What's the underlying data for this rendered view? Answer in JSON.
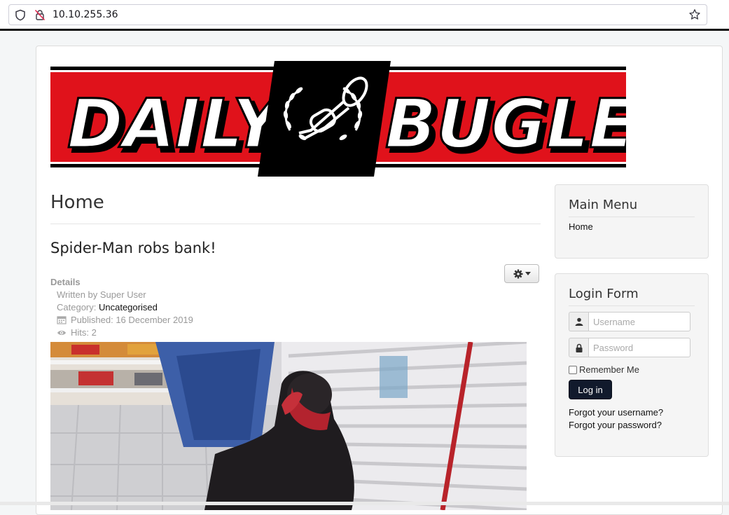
{
  "browser": {
    "url": "10.10.255.36"
  },
  "logo": {
    "word_left": "DAILY",
    "word_right": "BUGLE",
    "colors": {
      "red": "#e0121b",
      "black": "#000000",
      "white": "#ffffff"
    }
  },
  "main": {
    "page_title": "Home",
    "article": {
      "title": "Spider-Man robs bank!",
      "details_label": "Details",
      "written_by": "Written by Super User",
      "category_prefix": "Category: ",
      "category": "Uncategorised",
      "published": "Published: 16 December 2019",
      "hits": "Hits: 2"
    }
  },
  "sidebar": {
    "main_menu": {
      "title": "Main Menu",
      "items": [
        {
          "label": "Home"
        }
      ]
    },
    "login": {
      "title": "Login Form",
      "username_placeholder": "Username",
      "password_placeholder": "Password",
      "remember_label": "Remember Me",
      "login_label": "Log in",
      "forgot_username": "Forgot your username?",
      "forgot_password": "Forgot your password?"
    }
  }
}
